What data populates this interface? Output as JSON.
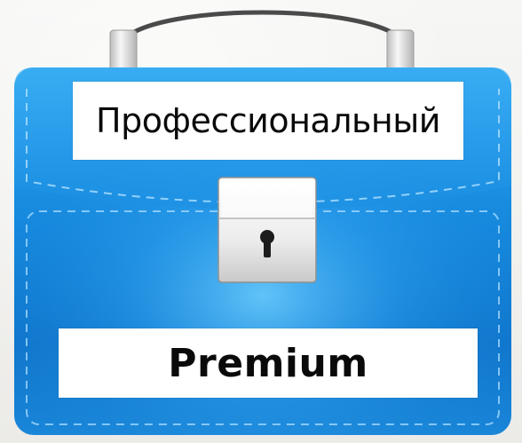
{
  "briefcase": {
    "top_label": "Профессиональный",
    "bottom_label": "Premium",
    "body_color": "#1a8fe0",
    "body_highlight_color": "#5cc3ff",
    "stitch_color": "#9fd6ff",
    "handle_color": "#e0e0e0",
    "lock_color": "#f2f2f2",
    "keyhole_color": "#1c1c1c"
  }
}
